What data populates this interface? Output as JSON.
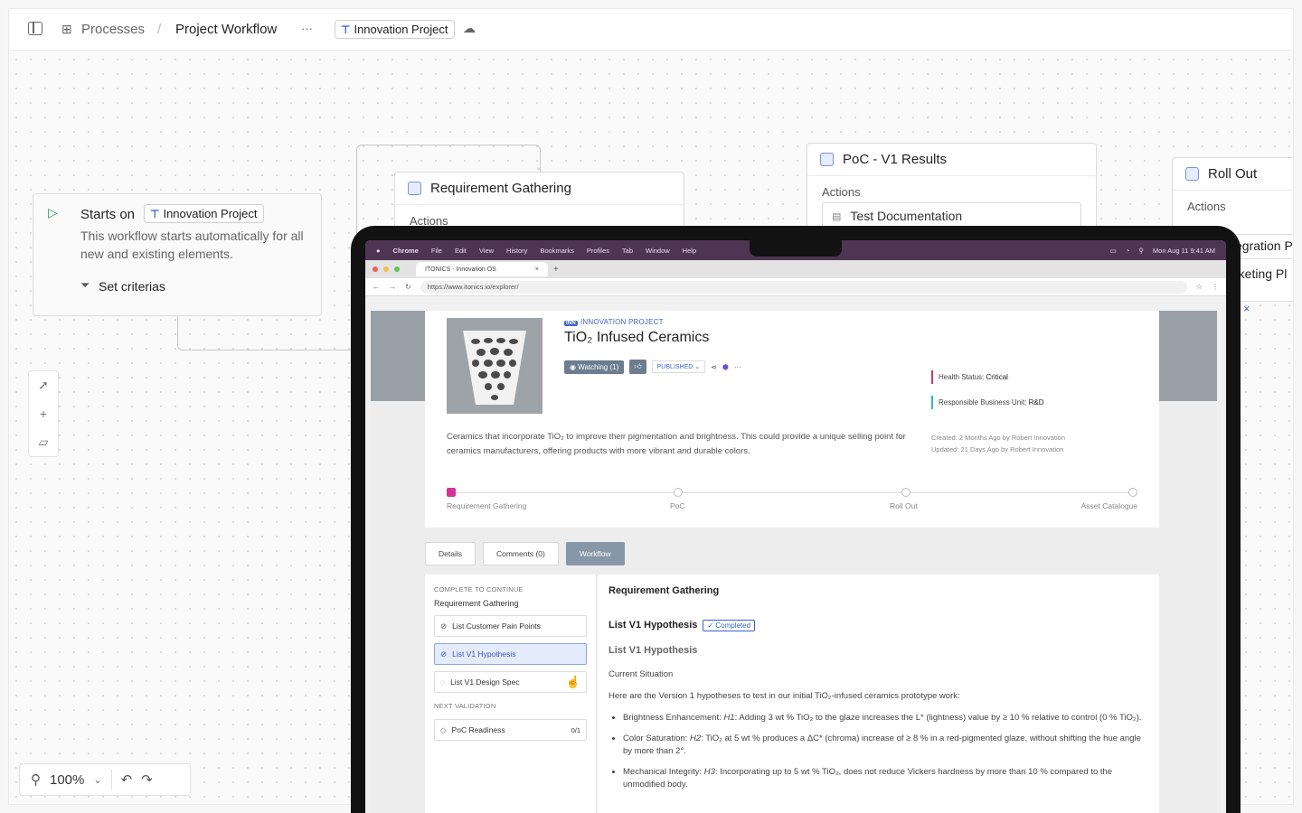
{
  "topbar": {
    "breadcrumb_root": "Processes",
    "breadcrumb_current": "Project Workflow",
    "more": "···",
    "chip_label": "Innovation Project"
  },
  "start_node": {
    "title": "Starts on",
    "chip_label": "Innovation Project",
    "description": "This workflow starts automatically for all new and existing elements.",
    "criteria_label": "Set criterias"
  },
  "nodes": {
    "req": {
      "title": "Requirement Gathering",
      "label": "Actions"
    },
    "poc": {
      "title": "PoC - V1 Results",
      "label": "Actions",
      "action": "Test Documentation"
    },
    "rollout": {
      "title": "Roll Out",
      "label": "Actions",
      "action1": "egration P",
      "action2": "rketing Pl",
      "close": "×"
    }
  },
  "zoom": {
    "value": "100%"
  },
  "mac_menu": {
    "app": "Chrome",
    "items": [
      "File",
      "Edit",
      "View",
      "History",
      "Bookmarks",
      "Profiles",
      "Tab",
      "Window",
      "Help"
    ],
    "clock": "Mon Aug 11  9:41 AM"
  },
  "browser": {
    "tab_title": "ITONICS - Innovation OS",
    "url": "https://www.itonics.io/explorer/"
  },
  "project": {
    "type_tag": "INN",
    "type": "INNOVATION PROJECT",
    "title": "TiO₂ Infused Ceramics",
    "watching": "Watching (1)",
    "published": "PUBLISHED",
    "health_label": "Health Status: ",
    "health_value": "Critical",
    "bu_label": "Responsible Business Unit: ",
    "bu_value": "R&D",
    "description": "Ceramics that incorporate TiO₂ to improve their pigmentation and brightness. This could provide a unique selling point for ceramics manufacturers, offering products with more vibrant and durable colors.",
    "created": "Created: 2 Months Ago by Robert Innovation",
    "updated": "Updated: 21 Days Ago by Robert Innovation",
    "stages": [
      "Requirement Gathering",
      "PoC",
      "Roll Out",
      "Asset Catalogue"
    ],
    "tabs": [
      "Details",
      "Comments (0)",
      "Workflow"
    ]
  },
  "workflow": {
    "complete_label": "COMPLETE TO CONTINUE",
    "stage_name": "Requirement Gathering",
    "tasks": [
      "List Customer Pain Points",
      "List V1 Hypothesis",
      "List V1 Design Spec"
    ],
    "next_label": "NEXT VALIDATION",
    "next_item": "PoC Readiness",
    "next_count": "0/1",
    "heading": "Requirement Gathering",
    "task_title": "List V1 Hypothesis",
    "task_status": "Completed",
    "sub_title": "List V1 Hypothesis",
    "section": "Current Situation",
    "intro": "Here are the Version 1 hypotheses to test in our initial TiO₂-infused ceramics prototype work:",
    "bullets": [
      {
        "lead": "Brightness Enhancement",
        "h": "H1",
        "text": ": Adding 3 wt % TiO₂ to the glaze increases the L* (lightness) value by ≥ 10 % relative to control (0 % TiO₂)."
      },
      {
        "lead": "Color Saturation",
        "h": "H2",
        "text": ": TiO₂ at 5 wt % produces a ΔC* (chroma) increase of ≥ 8 % in a red-pigmented glaze, without shifting the hue angle by more than 2°."
      },
      {
        "lead": "Mechanical Integrity",
        "h": "H3",
        "text": ": Incorporating up to 5 wt % TiO₂, does not reduce Vickers hardness by more than 10 % compared to the unmodified body."
      }
    ]
  },
  "colors": {
    "accent": "#4264c9",
    "menubar": "#4e3554",
    "health": "#d23a5b",
    "bu": "#2bb6d6",
    "stage_active": "#d6339a"
  }
}
